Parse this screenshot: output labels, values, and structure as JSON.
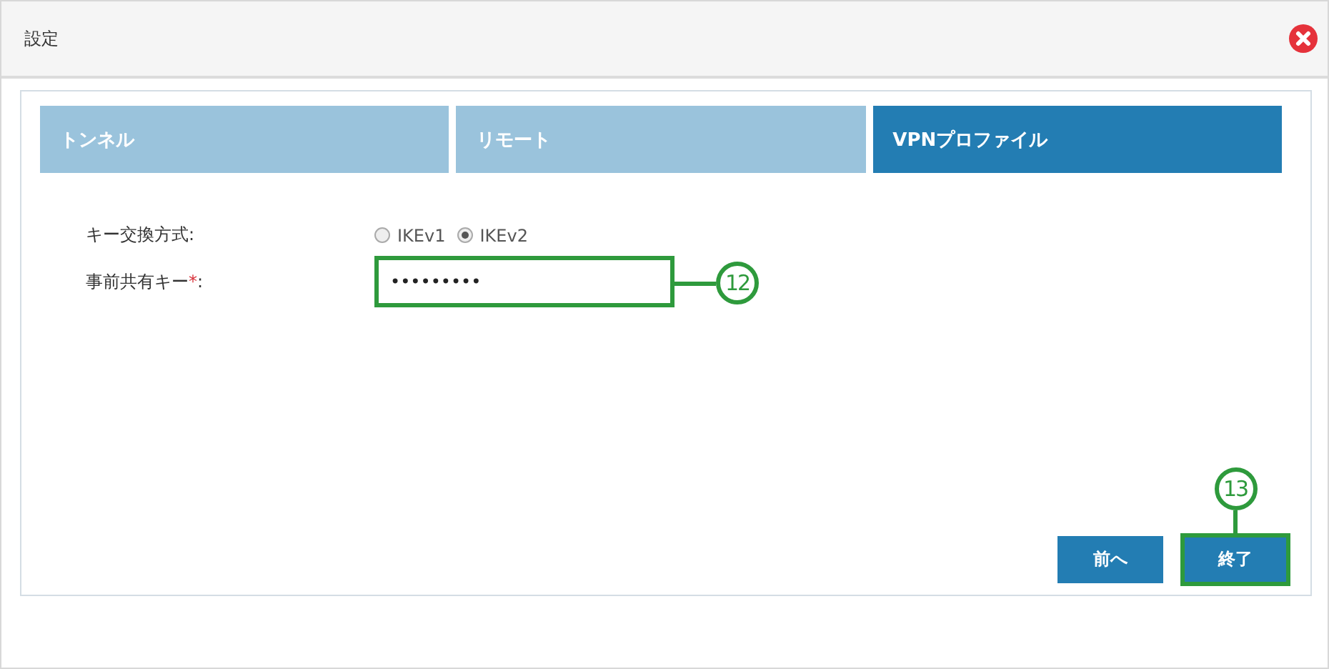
{
  "dialog": {
    "title": "設定"
  },
  "tabs": [
    {
      "label": "トンネル",
      "selected": false
    },
    {
      "label": "リモート",
      "selected": false
    },
    {
      "label": "VPNプロファイル",
      "selected": true
    }
  ],
  "key_exchange": {
    "label": "キー交換方式:",
    "options": [
      {
        "label": "IKEv1",
        "selected": false
      },
      {
        "label": "IKEv2",
        "selected": true
      }
    ]
  },
  "preshared_key": {
    "label": "事前共有キー",
    "required_mark": "*",
    "suffix": ":",
    "value": "•••••••••"
  },
  "buttons": [
    {
      "label": "前へ",
      "highlighted": false
    },
    {
      "label": "終了",
      "highlighted": true
    }
  ],
  "callouts": [
    {
      "number": "12"
    },
    {
      "number": "13"
    }
  ]
}
